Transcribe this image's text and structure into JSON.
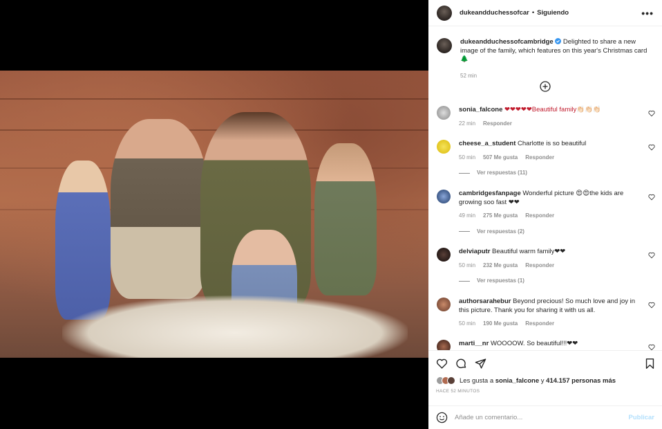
{
  "post": {
    "author": "dukeandduchessofcar",
    "separator": "•",
    "follow_status": "Siguiendo",
    "more_icon": "more-horizontal-icon"
  },
  "caption": {
    "username": "dukeandduchessofcambridge",
    "verified_icon": "verified-badge-icon",
    "text": "Delighted to share a new image of the family, which features on this year's Christmas card 🌲",
    "time": "52 min"
  },
  "load_more_icon": "plus-circle-icon",
  "comments": [
    {
      "username": "sonia_falcone",
      "text": "❤❤❤❤❤Beautiful family👏🏻👏🏻👏🏻",
      "time": "22 min",
      "likes": "",
      "reply": "Responder",
      "view_replies": ""
    },
    {
      "username": "cheese_a_student",
      "text": "Charlotte is so beautiful",
      "time": "50 min",
      "likes": "507 Me gusta",
      "reply": "Responder",
      "view_replies": "Ver respuestas (11)"
    },
    {
      "username": "cambridgesfanpage",
      "text": "Wonderful picture 😍😍the kids are growing soo fast ❤❤",
      "time": "49 min",
      "likes": "275 Me gusta",
      "reply": "Responder",
      "view_replies": "Ver respuestas (2)"
    },
    {
      "username": "delviaputr",
      "text": "Beautiful warm family❤❤",
      "time": "50 min",
      "likes": "232 Me gusta",
      "reply": "Responder",
      "view_replies": "Ver respuestas (1)"
    },
    {
      "username": "authorsarahebur",
      "text": "Beyond precious! So much love and joy in this picture. Thank you for sharing it with us all.",
      "time": "50 min",
      "likes": "190 Me gusta",
      "reply": "Responder",
      "view_replies": ""
    },
    {
      "username": "marti__nr",
      "text": "WOOOOW. So beautiful!!!❤❤",
      "time": "",
      "likes": "",
      "reply": "",
      "view_replies": ""
    }
  ],
  "actions": {
    "like_icon": "heart-icon",
    "comment_icon": "comment-icon",
    "share_icon": "send-icon",
    "save_icon": "bookmark-icon"
  },
  "likes_summary": {
    "prefix": "Les gusta a",
    "user": "sonia_falcone",
    "conjunction": "y",
    "count": "414.157 personas más"
  },
  "timestamp": "HACE 52 MINUTOS",
  "add_comment": {
    "placeholder": "Añade un comentario...",
    "emoji_icon": "emoji-smile-icon",
    "publish": "Publicar"
  },
  "colors": {
    "text": "#262626",
    "secondary": "#8e8e8e",
    "publish_disabled": "#b2dffc",
    "verified": "#3897f0"
  }
}
